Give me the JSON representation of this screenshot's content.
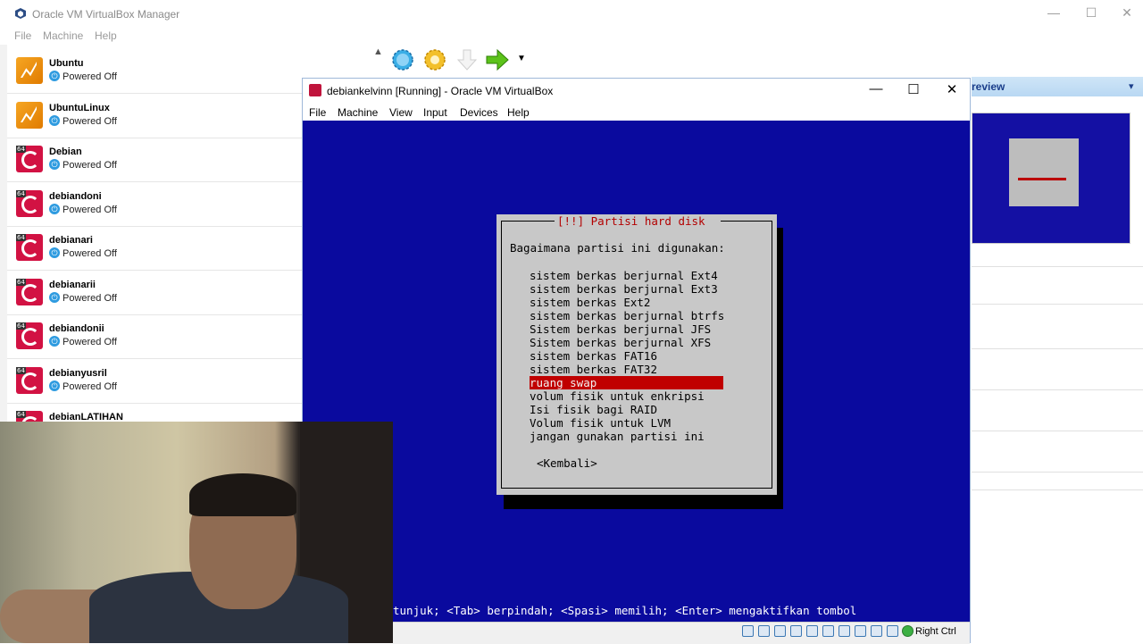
{
  "manager": {
    "title": "Oracle VM VirtualBox Manager",
    "menu": [
      "File",
      "Machine",
      "Help"
    ],
    "window_controls": {
      "minimize": "—",
      "maximize": "☐",
      "close": "✕"
    },
    "vms": [
      {
        "name": "Ubuntu",
        "state": "Powered Off",
        "os": "ubuntu"
      },
      {
        "name": "UbuntuLinux",
        "state": "Powered Off",
        "os": "ubuntu"
      },
      {
        "name": "Debian",
        "state": "Powered Off",
        "os": "debian"
      },
      {
        "name": "debiandoni",
        "state": "Powered Off",
        "os": "debian"
      },
      {
        "name": "debianari",
        "state": "Powered Off",
        "os": "debian"
      },
      {
        "name": "debianarii",
        "state": "Powered Off",
        "os": "debian"
      },
      {
        "name": "debiandonii",
        "state": "Powered Off",
        "os": "debian"
      },
      {
        "name": "debianyusril",
        "state": "Powered Off",
        "os": "debian"
      },
      {
        "name": "debianLATIHAN",
        "state": "",
        "os": "debian"
      }
    ],
    "os_badge": "64",
    "toolbar_icons": [
      "new-icon",
      "settings-icon",
      "discard-icon",
      "start-icon"
    ],
    "preview_title": "review"
  },
  "vm_window": {
    "title": "debiankelvinn [Running] - Oracle VM VirtualBox",
    "menu": [
      "File",
      "Machine",
      "View",
      "Input",
      "Devices",
      "Help"
    ],
    "controls": {
      "minimize": "—",
      "maximize": "☐",
      "close": "✕"
    }
  },
  "installer": {
    "dialog_title": "[!!] Partisi hard disk",
    "question": "Bagaimana partisi ini digunakan:",
    "options": [
      "sistem berkas berjurnal Ext4",
      "sistem berkas berjurnal Ext3",
      "sistem berkas Ext2",
      "sistem berkas berjurnal btrfs",
      "Sistem berkas berjurnal JFS",
      "Sistem berkas berjurnal XFS",
      "sistem berkas FAT16",
      "sistem berkas FAT32",
      "ruang swap",
      "volum fisik untuk enkripsi",
      "Isi fisik bagi RAID",
      "Volum fisik untuk LVM",
      "jangan gunakan partisi ini"
    ],
    "selected_index": 8,
    "back_button": "<Kembali>",
    "help_line": "tunjuk; <Tab> berpindah; <Spasi> memilih; <Enter> mengaktifkan tombol"
  },
  "statusbar": {
    "host_key": "Right Ctrl",
    "icons": [
      "hdd-icon",
      "optical-icon",
      "audio-icon",
      "network-icon",
      "usb-icon",
      "shared-folder-icon",
      "display-icon",
      "recording-icon",
      "capture-icon",
      "virtualization-icon",
      "mouse-integration-icon"
    ]
  },
  "colors": {
    "vm_screen": "#0a0a9e",
    "dialog_bg": "#c8c8c8",
    "selection": "#c00000",
    "title_red": "#b30000"
  }
}
